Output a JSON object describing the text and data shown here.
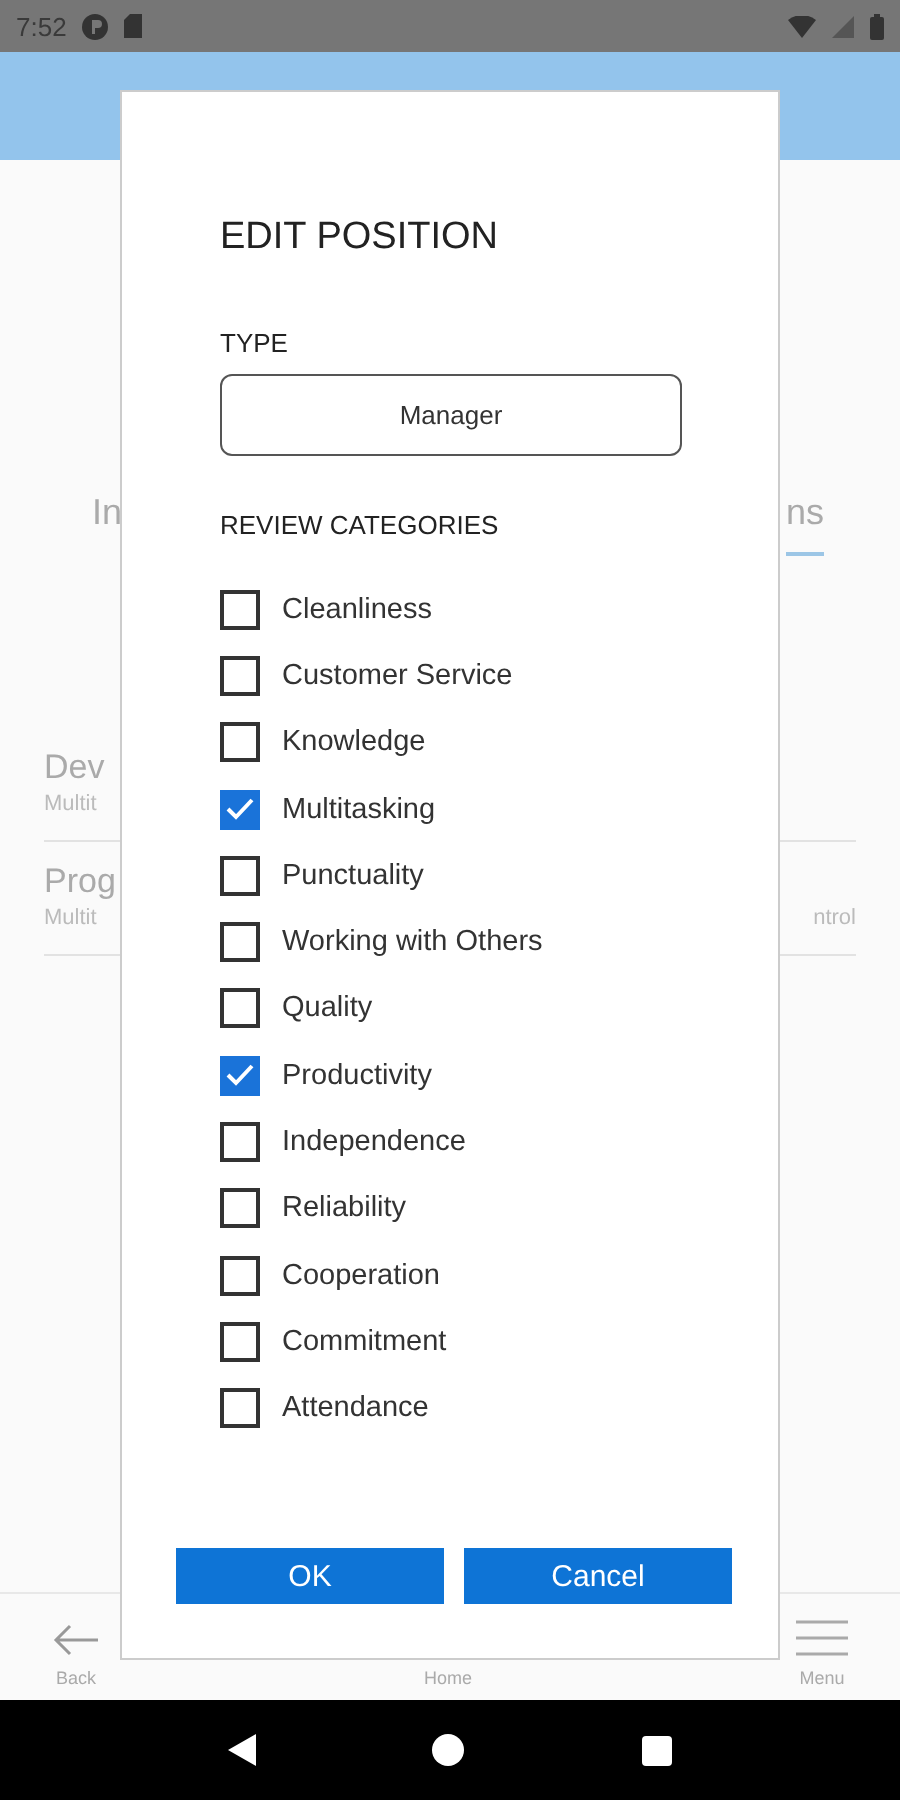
{
  "status_bar": {
    "time": "7:52"
  },
  "background": {
    "tabs": [
      {
        "label": "In",
        "selected": false
      },
      {
        "label": "ns",
        "selected": true
      }
    ],
    "items": [
      {
        "title": "Dev",
        "subtitle": "Multit"
      },
      {
        "title": "Prog",
        "subtitle": "Multit",
        "detail": "ntrol"
      }
    ],
    "bottom_nav": [
      {
        "label": "Back",
        "kind": "back"
      },
      {
        "label": "Home",
        "kind": "home"
      },
      {
        "label": "Menu",
        "kind": "menu"
      }
    ]
  },
  "dialog": {
    "title": "EDIT POSITION",
    "type_label": "TYPE",
    "type_value": "Manager",
    "categories_label": "REVIEW CATEGORIES",
    "categories": [
      {
        "label": "Cleanliness",
        "checked": false
      },
      {
        "label": "Customer Service",
        "checked": false
      },
      {
        "label": "Knowledge",
        "checked": false
      },
      {
        "label": "Multitasking",
        "checked": true
      },
      {
        "label": "Punctuality",
        "checked": false
      },
      {
        "label": "Working with Others",
        "checked": false
      },
      {
        "label": "Quality",
        "checked": false
      },
      {
        "label": "Productivity",
        "checked": true
      },
      {
        "label": "Independence",
        "checked": false
      },
      {
        "label": "Reliability",
        "checked": false
      },
      {
        "label": "Cooperation",
        "checked": false
      },
      {
        "label": "Commitment",
        "checked": false
      },
      {
        "label": "Attendance",
        "checked": false
      }
    ],
    "buttons": [
      "OK",
      "Cancel"
    ]
  }
}
